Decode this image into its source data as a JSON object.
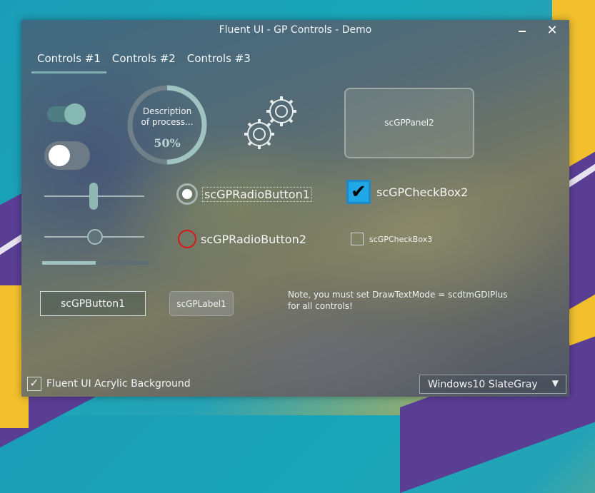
{
  "window": {
    "title": "Fluent UI - GP Controls - Demo",
    "minimize_icon": "minimize-icon",
    "close_icon": "close-icon",
    "close_glyph": "✕"
  },
  "tabs": [
    {
      "label": "Controls #1",
      "active": true
    },
    {
      "label": "Controls #2",
      "active": false
    },
    {
      "label": "Controls #3",
      "active": false
    }
  ],
  "controls": {
    "toggle1": {
      "checked": true
    },
    "toggle2": {
      "checked": false
    },
    "slider1_value": 0.5,
    "slider2_value": 0.5,
    "progress_bar_value": 0.5,
    "circular_progress": {
      "line1": "Description",
      "line2": "of process...",
      "value_text": "50%",
      "value": 0.5
    },
    "gears_icon": "gears-icon",
    "panel2": {
      "label": "scGPPanel2"
    },
    "radio1": {
      "label": "scGPRadioButton1",
      "checked": true
    },
    "radio2": {
      "label": "scGPRadioButton2",
      "checked": false
    },
    "checkbox2": {
      "label": "scGPCheckBox2",
      "checked": true,
      "check_glyph": "✔"
    },
    "checkbox3": {
      "label": "scGPCheckBox3",
      "checked": false
    },
    "button1": {
      "label": "scGPButton1"
    },
    "label1": {
      "text": "scGPLabel1"
    },
    "note": {
      "line1": "Note, you must set DrawTextMode = scdtmGDIPlus",
      "line2": "for all controls!"
    }
  },
  "footer": {
    "acrylic_checkbox": {
      "label": "Fluent UI Acrylic Background",
      "checked": true,
      "check_glyph": "✓"
    },
    "style_select": {
      "value": "Windows10 SlateGray",
      "chevron_glyph": "▼"
    }
  },
  "colors": {
    "accent": "#87b9b4",
    "checkbox_fill": "#1fa7e6",
    "radio2_ring": "#d31b1b"
  }
}
